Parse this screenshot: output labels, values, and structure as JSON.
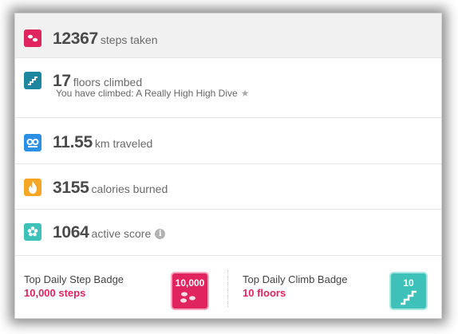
{
  "stats": [
    {
      "value": "12367",
      "label": "steps taken",
      "icon": "footprints-icon",
      "color": "#e0245e"
    },
    {
      "value": "17",
      "label": "floors climbed",
      "icon": "stairs-icon",
      "color": "#1f86a0",
      "subtitle": "You have climbed: A Really High High Dive"
    },
    {
      "value": "11.55",
      "label": "km traveled",
      "icon": "distance-icon",
      "color": "#2d8fe3"
    },
    {
      "value": "3155",
      "label": "calories burned",
      "icon": "flame-icon",
      "color": "#f5a623"
    },
    {
      "value": "1064",
      "label": "active score",
      "icon": "flower-icon",
      "color": "#3ec1b8"
    }
  ],
  "badges": [
    {
      "title": "Top Daily Step Badge",
      "value": "10,000 steps",
      "badge_text": "10,000",
      "icon": "step-badge-icon",
      "color": "#e0245e"
    },
    {
      "title": "Top Daily Climb Badge",
      "value": "10 floors",
      "badge_text": "10",
      "icon": "climb-badge-icon",
      "color": "#3ec1b8"
    }
  ]
}
